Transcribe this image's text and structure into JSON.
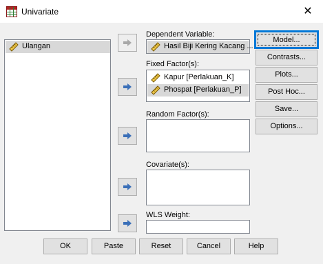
{
  "window": {
    "title": "Univariate",
    "close_glyph": "✕"
  },
  "icons": {
    "app": "univariate-grid-icon",
    "variable": "ruler-icon",
    "arrow": "arrow-right-icon",
    "close": "close-icon"
  },
  "variables": {
    "items": [
      {
        "label": "Ulangan"
      }
    ]
  },
  "dependent": {
    "label": "Dependent Variable:",
    "value": "Hasil Biji Kering Kacang ..."
  },
  "fixed_factors": {
    "label": "Fixed Factor(s):",
    "items": [
      {
        "label": "Kapur [Perlakuan_K]"
      },
      {
        "label": "Phospat [Perlakuan_P]"
      }
    ]
  },
  "random_factors": {
    "label": "Random Factor(s):"
  },
  "covariates": {
    "label": "Covariate(s):"
  },
  "wls": {
    "label": "WLS Weight:"
  },
  "side_buttons": {
    "model": "Model...",
    "contrasts": "Contrasts...",
    "plots": "Plots...",
    "posthoc": "Post Hoc...",
    "save": "Save...",
    "options": "Options..."
  },
  "bottom_buttons": {
    "ok": "OK",
    "paste": "Paste",
    "reset": "Reset",
    "cancel": "Cancel",
    "help": "Help"
  },
  "colors": {
    "focus_border": "#0078d7",
    "arrow_blue": "#3a6fb8",
    "selected_item": "#d8d8d8"
  }
}
